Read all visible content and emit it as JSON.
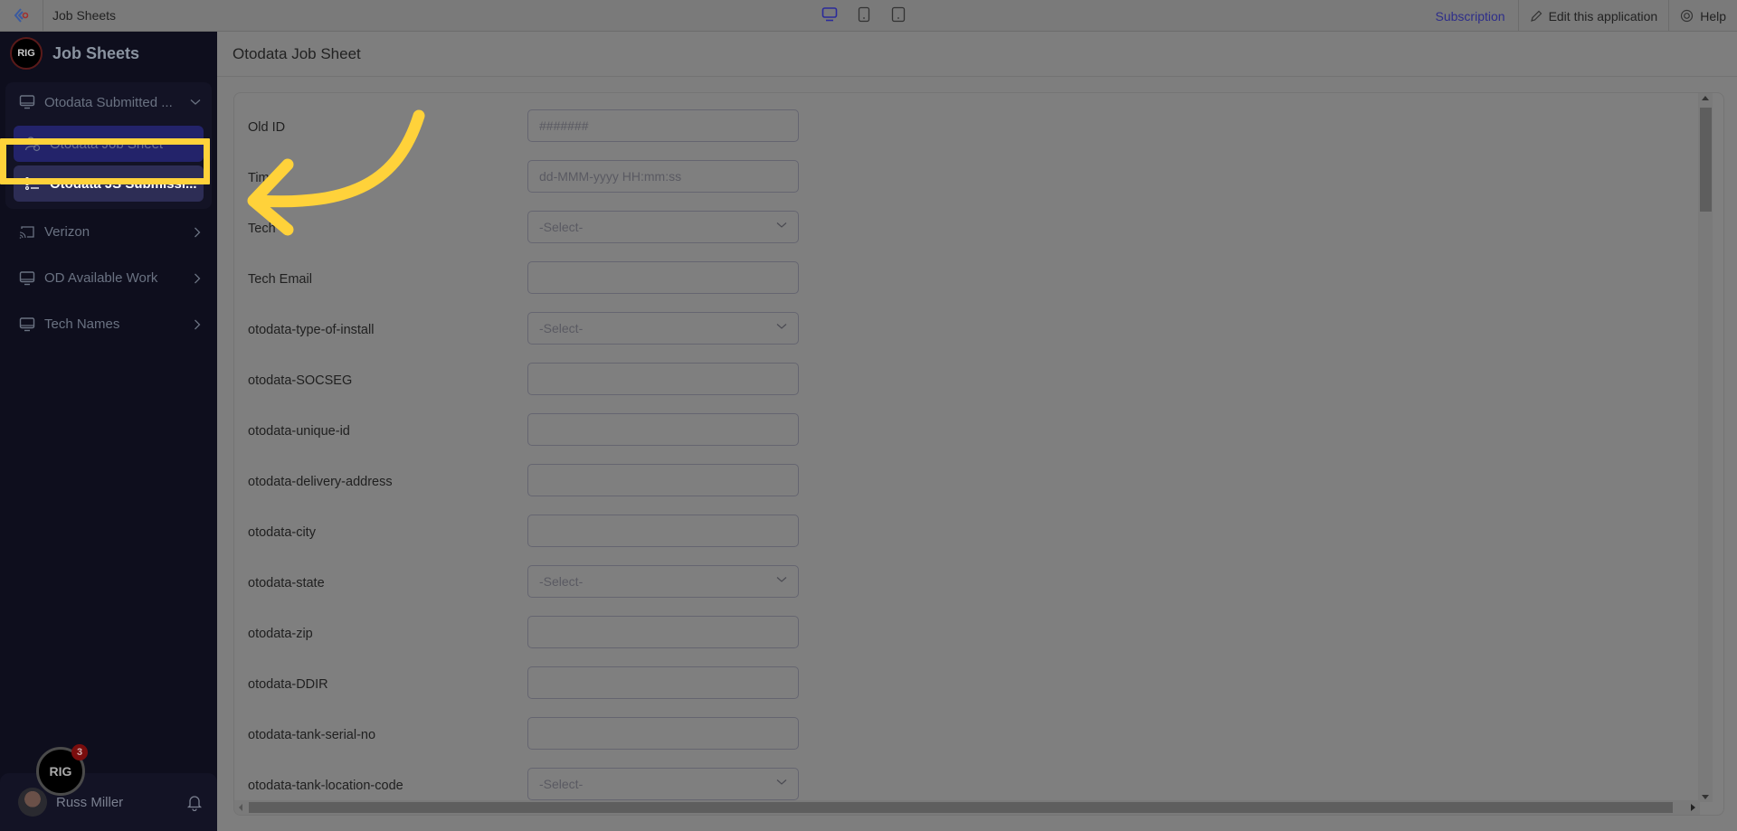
{
  "topbar": {
    "app_title": "Job Sheets",
    "subscription_label": "Subscription",
    "edit_label": "Edit this application",
    "help_label": "Help",
    "devices": [
      "desktop-icon",
      "tablet-icon",
      "mobile-icon"
    ]
  },
  "sidebar": {
    "brand_logo_text": "RIG",
    "brand_name": "Job Sheets",
    "group": {
      "label": "Otodata Submitted ...",
      "items": [
        {
          "label": "Otodata Job Sheet",
          "icon": "user-clock-icon"
        },
        {
          "label": "Otodata JS Submissi...",
          "icon": "list-icon",
          "active": true
        }
      ]
    },
    "nav_items": [
      {
        "label": "Verizon",
        "icon": "cast-icon"
      },
      {
        "label": "OD Available Work",
        "icon": "monitor-icon"
      },
      {
        "label": "Tech Names",
        "icon": "monitor-icon"
      }
    ],
    "user": {
      "name": "Russ Miller",
      "notification_count": "3",
      "floating_logo_text": "RIG"
    }
  },
  "main": {
    "page_title": "Otodata Job Sheet",
    "fields": [
      {
        "label": "Old ID",
        "type": "text",
        "placeholder": "#######"
      },
      {
        "label": "Tim",
        "type": "text",
        "placeholder": "dd-MMM-yyyy HH:mm:ss"
      },
      {
        "label": "Tech",
        "type": "select",
        "placeholder": "-Select-"
      },
      {
        "label": "Tech Email",
        "type": "text",
        "placeholder": ""
      },
      {
        "label": "otodata-type-of-install",
        "type": "select",
        "placeholder": "-Select-"
      },
      {
        "label": "otodata-SOCSEG",
        "type": "text",
        "placeholder": ""
      },
      {
        "label": "otodata-unique-id",
        "type": "text",
        "placeholder": ""
      },
      {
        "label": "otodata-delivery-address",
        "type": "text",
        "placeholder": ""
      },
      {
        "label": "otodata-city",
        "type": "text",
        "placeholder": ""
      },
      {
        "label": "otodata-state",
        "type": "select",
        "placeholder": "-Select-"
      },
      {
        "label": "otodata-zip",
        "type": "text",
        "placeholder": ""
      },
      {
        "label": "otodata-DDIR",
        "type": "text",
        "placeholder": ""
      },
      {
        "label": "otodata-tank-serial-no",
        "type": "text",
        "placeholder": ""
      },
      {
        "label": "otodata-tank-location-code",
        "type": "select",
        "placeholder": "-Select-"
      }
    ]
  },
  "colors": {
    "highlight": "#ffd23a",
    "sidebar_bg": "#0e0e1d",
    "accent": "#23236a"
  }
}
